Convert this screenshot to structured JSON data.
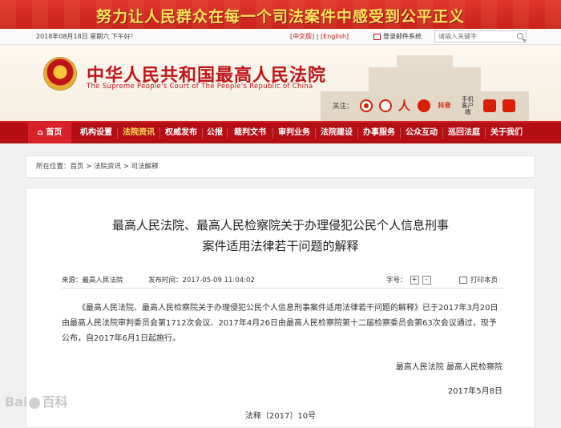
{
  "banner": {
    "slogan": "努力让人民群众在每一个司法案件中感受到公平正义"
  },
  "utility": {
    "date": "2018年08月18日  星期六    下午好！",
    "lang_cn": "[中文版]",
    "lang_sep": "|",
    "lang_en": "[English]",
    "login": "登录邮件系统",
    "search_placeholder": "请输入关键字"
  },
  "header": {
    "title": "中华人民共和国最高人民法院",
    "subtitle": "The Supreme People's Court of The People's Republic of China",
    "follow_label": "关注：",
    "mobile_client_line1": "手机",
    "mobile_client_line2": "客户端"
  },
  "nav": {
    "items": [
      "首页",
      "机构设置",
      "法院资讯",
      "权威发布",
      "公报",
      "裁判文书",
      "审判业务",
      "法院建设",
      "办事服务",
      "公众互动",
      "巡回法庭",
      "关于我们"
    ],
    "active_index": 2
  },
  "breadcrumb": {
    "text": "所在位置：首页  >  法院资讯  >  司法解释"
  },
  "article": {
    "title_line1": "最高人民法院、最高人民检察院关于办理侵犯公民个人信息刑事",
    "title_line2": "案件适用法律若干问题的解释",
    "source": "来源：最高人民法院",
    "publish_time": "发布时间：2017-05-09 11:04:02",
    "font_size_label": "字号：",
    "font_plus": "+",
    "font_minus": "-",
    "print_label": "打印本页",
    "body": "《最高人民法院、最高人民检察院关于办理侵犯公民个人信息刑事案件适用法律若干问题的解释》已于2017年3月20日由最高人民法院审判委员会第1712次会议、2017年4月26日由最高人民检察院第十二届检察委员会第63次会议通过，现予公布，自2017年6月1日起施行。",
    "signers": "最高人民法院      最高人民检察院",
    "date": "2017年5月8日",
    "doc_no": "法释〔2017〕10号"
  },
  "watermark": {
    "left": "Bai",
    "right": "百科"
  },
  "colors": {
    "accent": "#c0141a",
    "nav_bg": "#b50f16",
    "slogan": "#ffe45c"
  }
}
